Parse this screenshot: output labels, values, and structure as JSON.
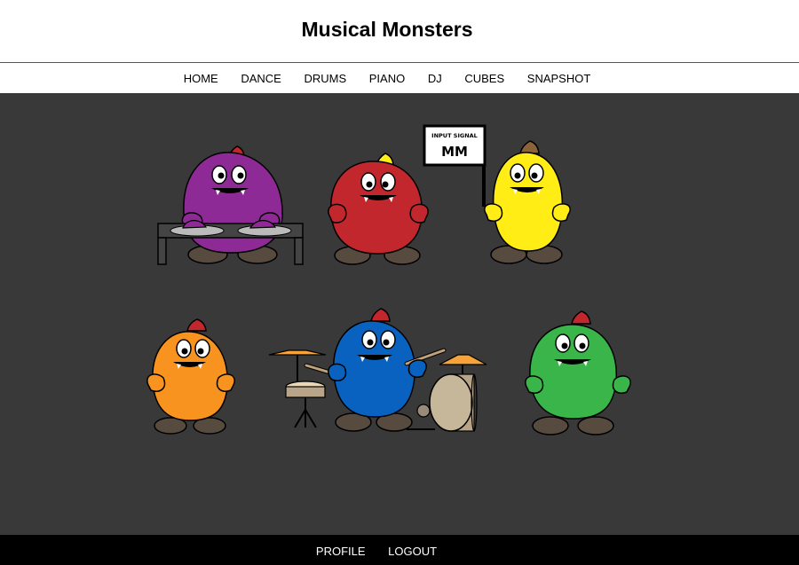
{
  "header": {
    "title": "Musical Monsters"
  },
  "nav": {
    "items": [
      "HOME",
      "DANCE",
      "DRUMS",
      "PIANO",
      "DJ",
      "CUBES",
      "SNAPSHOT"
    ]
  },
  "stage": {
    "sign": {
      "title": "INPUT SIGNAL",
      "value": "MM"
    },
    "monsters": [
      {
        "name": "dj-monster",
        "color": "#8e2a96"
      },
      {
        "name": "red-monster",
        "color": "#c1272d"
      },
      {
        "name": "yellow-monster",
        "color": "#ffed15"
      },
      {
        "name": "orange-monster",
        "color": "#f7931e"
      },
      {
        "name": "drummer-monster",
        "color": "#0a62c0"
      },
      {
        "name": "green-monster",
        "color": "#39b54a"
      }
    ]
  },
  "footer": {
    "items": [
      "PROFILE",
      "LOGOUT"
    ]
  },
  "colors": {
    "stage_bg": "#393939",
    "footer_bg": "#000000",
    "feet": "#574a3e",
    "cymbal": "#f6a43a"
  }
}
